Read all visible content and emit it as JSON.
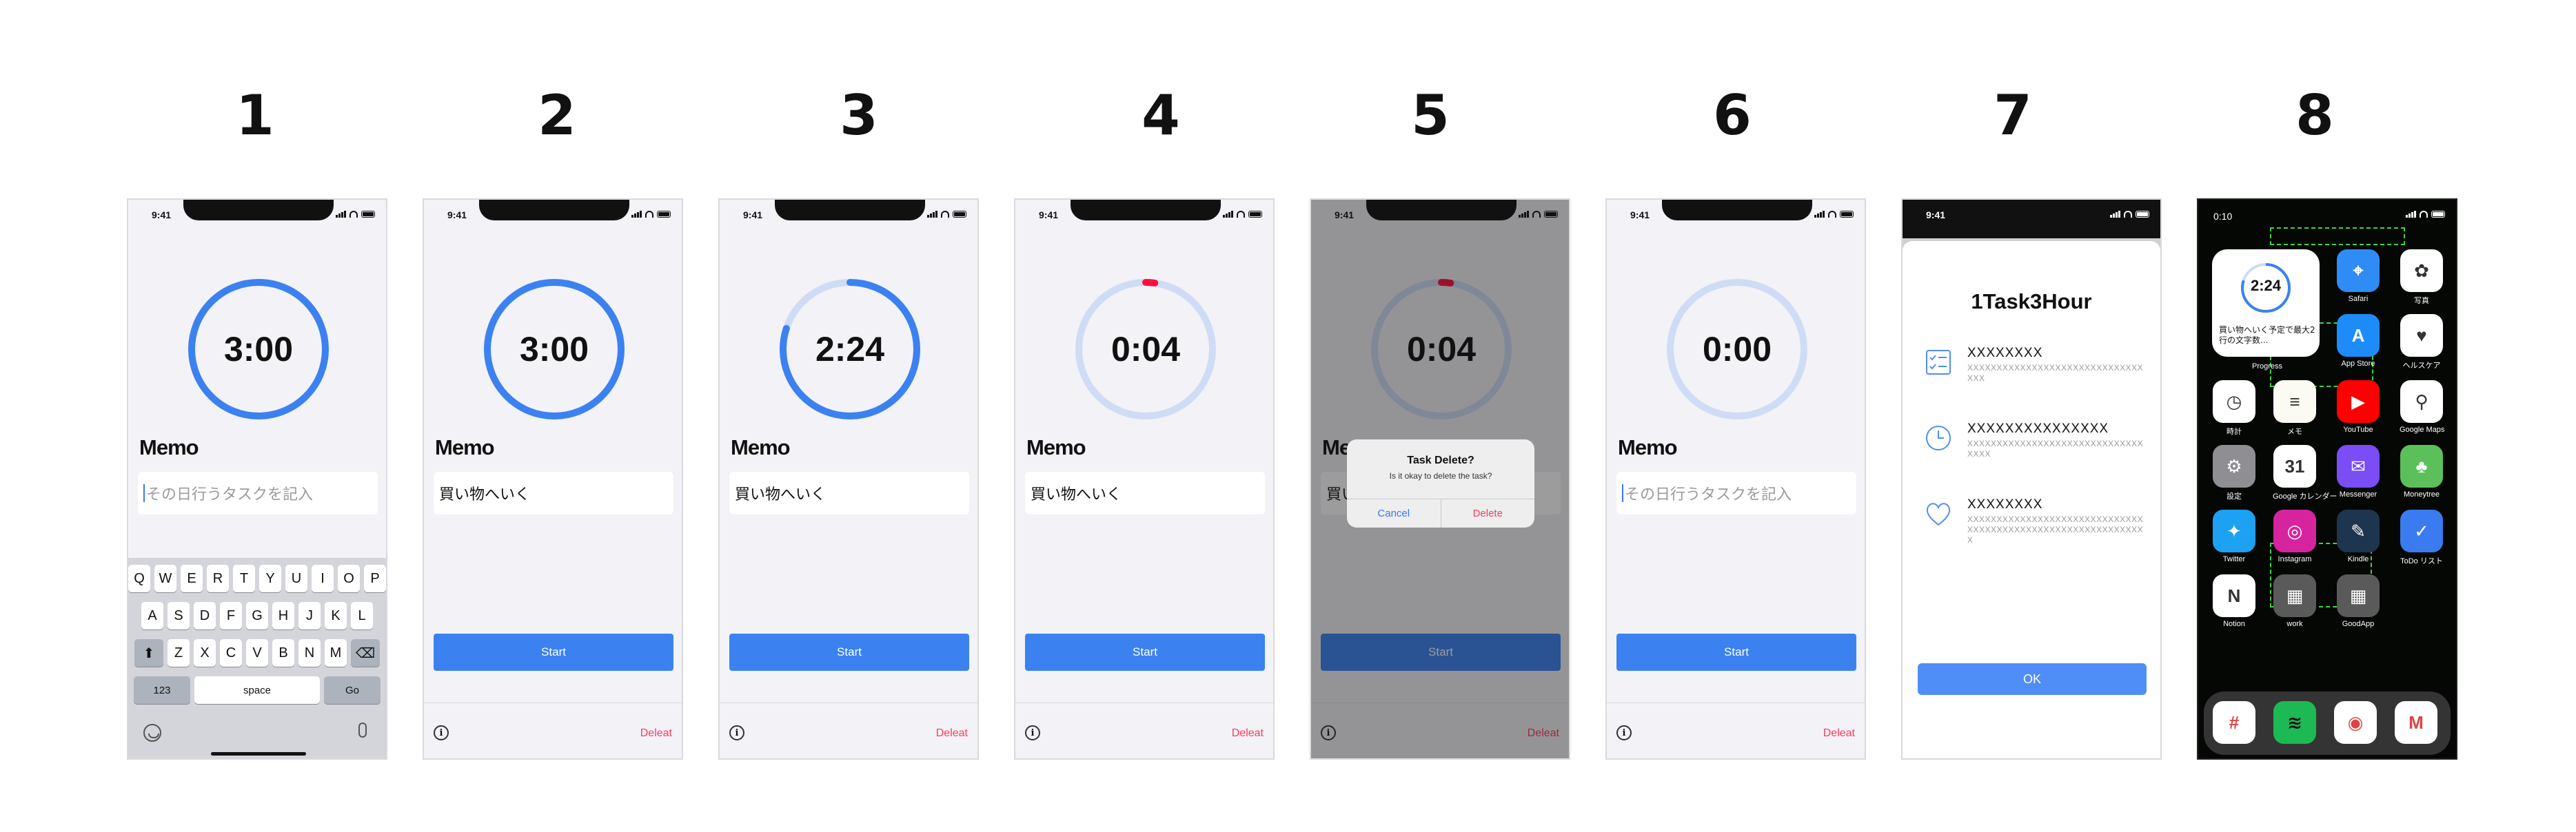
{
  "steps": [
    "1",
    "2",
    "3",
    "4",
    "5",
    "6",
    "7",
    "8"
  ],
  "status_time": "9:41",
  "memo_title": "Memo",
  "memo_placeholder": "その日行うタスクを記入",
  "memo_value": "買い物へいく",
  "start_label": "Start",
  "deleat_label": "Deleat",
  "info_glyph": "i",
  "timers": [
    {
      "time": "3:00",
      "progress": 1.0,
      "color": "#3b82f0"
    },
    {
      "time": "3:00",
      "progress": 1.0,
      "color": "#3b82f0"
    },
    {
      "time": "2:24",
      "progress": 0.8,
      "color": "#3b82f0"
    },
    {
      "time": "0:04",
      "progress": 0.022,
      "color": "#ff0f3e"
    },
    {
      "time": "0:04",
      "progress": 0.022,
      "color": "#ff0f3e"
    },
    {
      "time": "0:00",
      "progress": 0.0,
      "color": "#3b82f0"
    }
  ],
  "keyboard": {
    "row1": [
      "Q",
      "W",
      "E",
      "R",
      "T",
      "Y",
      "U",
      "I",
      "O",
      "P"
    ],
    "row2": [
      "A",
      "S",
      "D",
      "F",
      "G",
      "H",
      "J",
      "K",
      "L"
    ],
    "row3": [
      "Z",
      "X",
      "C",
      "V",
      "B",
      "N",
      "M"
    ],
    "numbers": "123",
    "space": "space",
    "go": "Go"
  },
  "alert": {
    "title": "Task Delete?",
    "message": "Is it okay to delete the task?",
    "cancel": "Cancel",
    "delete": "Delete"
  },
  "onboarding": {
    "title": "1Task3Hour",
    "features": [
      {
        "head": "XXXXXXXX",
        "desc": "XXXXXXXXXXXXXXXXXXXXXXXXXXXXXXXXX",
        "icon": "checklist-icon"
      },
      {
        "head": "XXXXXXXXXXXXXXX",
        "desc": "XXXXXXXXXXXXXXXXXXXXXXXXXXXXXXXXXX",
        "icon": "clock-icon"
      },
      {
        "head": "XXXXXXXX",
        "desc": "XXXXXXXXXXXXXXXXXXXXXXXXXXXXXXXXXXXXXXXXXXXXXXXXXXXXXXXXXXXXX",
        "icon": "heart-icon"
      }
    ],
    "ok": "OK"
  },
  "home": {
    "time": "0:10",
    "widget": {
      "time": "2:24",
      "memo": "買い物へいく予定で最大2行の文字数...",
      "progress": 0.8,
      "label": "Progress"
    },
    "apps": [
      {
        "label": "Safari",
        "icon": "compass-icon",
        "color": "#2f8cf4",
        "glyph": "⌖"
      },
      {
        "label": "写真",
        "icon": "photos-icon",
        "color": "#ffffff",
        "glyph": "✿"
      },
      {
        "label": "App Store",
        "icon": "appstore-icon",
        "color": "#1d8cf8",
        "glyph": "A"
      },
      {
        "label": "ヘルスケア",
        "icon": "health-icon",
        "color": "#ffffff",
        "glyph": "♥"
      },
      {
        "label": "時計",
        "icon": "clock-icon",
        "color": "#ffffff",
        "glyph": "◷"
      },
      {
        "label": "メモ",
        "icon": "notes-icon",
        "color": "#fbfbf3",
        "glyph": "≡"
      },
      {
        "label": "YouTube",
        "icon": "youtube-icon",
        "color": "#ff0000",
        "glyph": "▶"
      },
      {
        "label": "Google Maps",
        "icon": "maps-icon",
        "color": "#ffffff",
        "glyph": "⚲"
      },
      {
        "label": "設定",
        "icon": "settings-icon",
        "color": "#8e8e93",
        "glyph": "⚙"
      },
      {
        "label": "Google カレンダー",
        "icon": "calendar-icon",
        "color": "#ffffff",
        "glyph": "31"
      },
      {
        "label": "Messenger",
        "icon": "messenger-icon",
        "color": "#7b4df5",
        "glyph": "✉"
      },
      {
        "label": "Moneytree",
        "icon": "moneytree-icon",
        "color": "#5cc05a",
        "glyph": "♣"
      },
      {
        "label": "Twitter",
        "icon": "twitter-icon",
        "color": "#1da1f2",
        "glyph": "✦"
      },
      {
        "label": "Instagram",
        "icon": "instagram-icon",
        "color": "#d6249f",
        "glyph": "◎"
      },
      {
        "label": "Kindle",
        "icon": "kindle-icon",
        "color": "#1e3550",
        "glyph": "✎"
      },
      {
        "label": "ToDo リスト",
        "icon": "todo-icon",
        "color": "#3a7bf0",
        "glyph": "✓"
      },
      {
        "label": "Notion",
        "icon": "notion-icon",
        "color": "#ffffff",
        "glyph": "N"
      },
      {
        "label": "work",
        "icon": "folder-icon",
        "color": "#5a5a5a",
        "glyph": "▦"
      },
      {
        "label": "GoodApp",
        "icon": "folder-icon",
        "color": "#5a5a5a",
        "glyph": "▦"
      }
    ],
    "dock": [
      {
        "label": "Slack",
        "icon": "slack-icon",
        "color": "#ffffff",
        "glyph": "#"
      },
      {
        "label": "Spotify",
        "icon": "spotify-icon",
        "color": "#1db954",
        "glyph": "≋"
      },
      {
        "label": "Chrome",
        "icon": "chrome-icon",
        "color": "#ffffff",
        "glyph": "◉"
      },
      {
        "label": "Gmail",
        "icon": "gmail-icon",
        "color": "#ffffff",
        "glyph": "M"
      }
    ]
  }
}
